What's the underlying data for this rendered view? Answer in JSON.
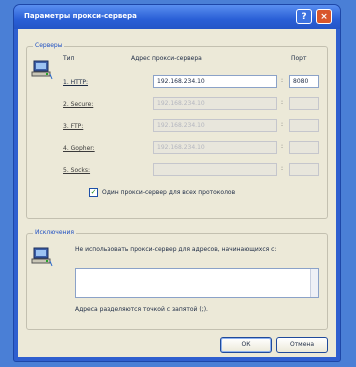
{
  "window": {
    "title": "Параметры прокси-сервера",
    "help_glyph": "?",
    "close_glyph": "×"
  },
  "servers": {
    "legend": "Серверы",
    "header_type": "Тип",
    "header_address": "Адрес прокси-сервера",
    "header_port": "Порт",
    "rows": [
      {
        "label": "1. HTTP:",
        "address": "192.168.234.10",
        "port": "8080",
        "enabled": true
      },
      {
        "label": "2. Secure:",
        "address": "192.168.234.10",
        "port": "",
        "enabled": false
      },
      {
        "label": "3. FTP:",
        "address": "192.168.234.10",
        "port": "",
        "enabled": false
      },
      {
        "label": "4. Gopher:",
        "address": "192.168.234.10",
        "port": "",
        "enabled": false
      },
      {
        "label": "5. Socks:",
        "address": "",
        "port": "",
        "enabled": false
      }
    ],
    "same_proxy_label": "Один прокси-сервер для всех протоколов",
    "same_proxy_checked": true
  },
  "exceptions": {
    "legend": "Исключения",
    "description": "Не использовать прокси-сервер для адресов, начинающихся с:",
    "textarea_value": "",
    "hint": "Адреса разделяются точкой с запятой (;)."
  },
  "buttons": {
    "ok": "ОК",
    "cancel": "Отмена"
  },
  "colors": {
    "titlebar": "#2456c7",
    "dialog_bg": "#ece9d8",
    "legend_text": "#1e4fc2"
  }
}
